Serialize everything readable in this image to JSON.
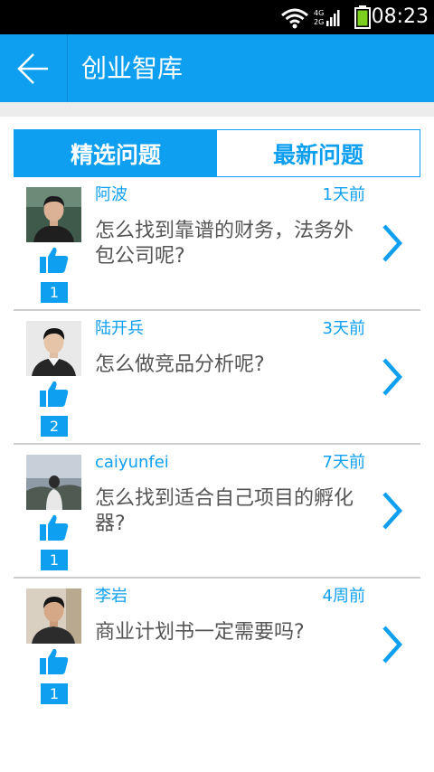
{
  "status_bar": {
    "time": "08:23",
    "network_top": "4G",
    "network_bottom": "2G",
    "icons": [
      "wifi-icon",
      "cell-signal-icon",
      "battery-icon"
    ]
  },
  "app_bar": {
    "title": "创业智库",
    "back_icon": "arrow-left-icon"
  },
  "tabs": [
    {
      "label": "精选问题",
      "active": true
    },
    {
      "label": "最新问题",
      "active": false
    }
  ],
  "questions": [
    {
      "user": "阿波",
      "time": "1天前",
      "text": "怎么找到靠谱的财务，法务外包公司呢?",
      "likes": "1"
    },
    {
      "user": "陆开兵",
      "time": "3天前",
      "text": "怎么做竞品分析呢?",
      "likes": "2"
    },
    {
      "user": "caiyunfei",
      "time": "7天前",
      "text": "怎么找到适合自己项目的孵化器?",
      "likes": "1"
    },
    {
      "user": "李岩",
      "time": "4周前",
      "text": "商业计划书一定需要吗?",
      "likes": "1"
    }
  ],
  "colors": {
    "accent": "#0e9ff0",
    "status_bar": "#000000",
    "question_text": "#555555",
    "separator": "#cfcfcf"
  }
}
